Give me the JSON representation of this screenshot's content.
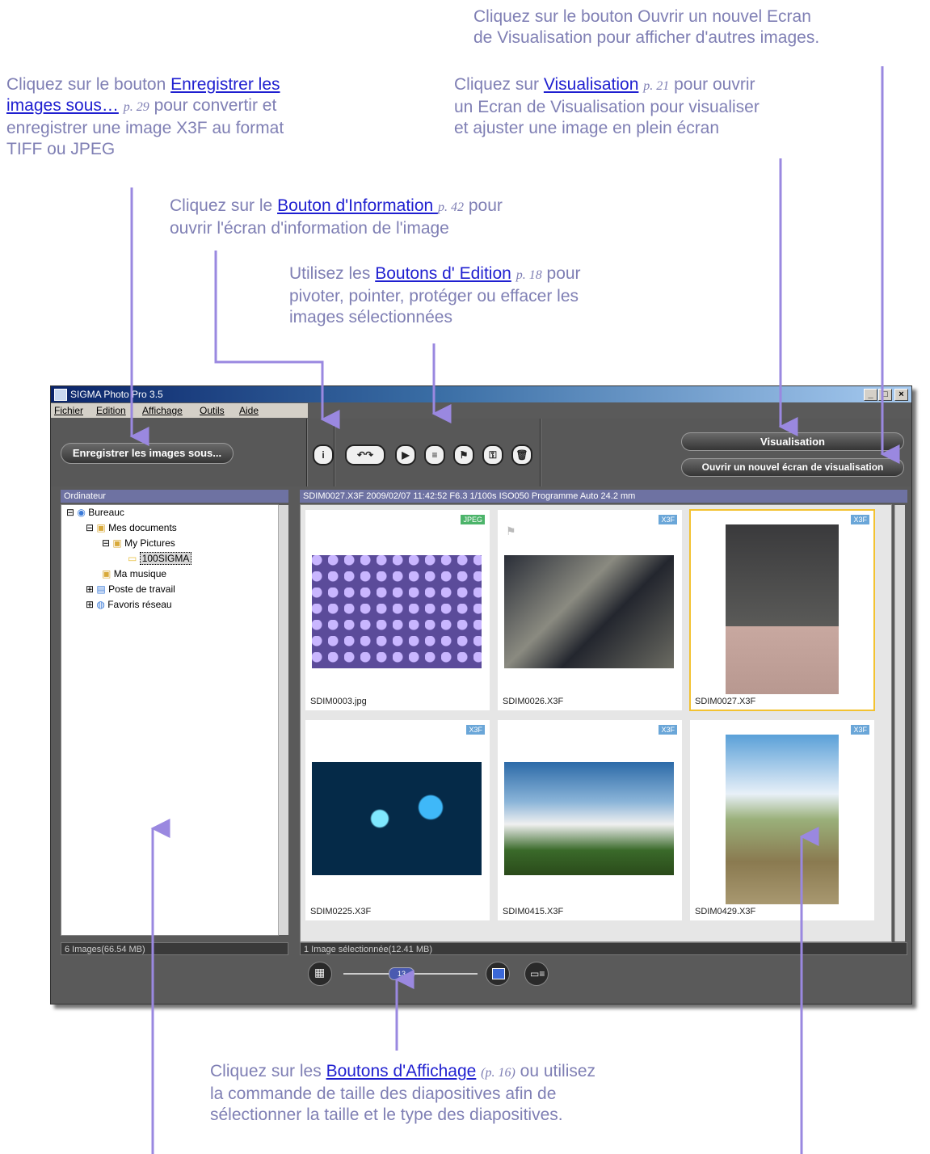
{
  "annotations": {
    "top_right": [
      "Cliquez sur le bouton Ouvrir un nouvel Ecran",
      "de Visualisation pour afficher d'autres images."
    ],
    "visualisation": {
      "before": "Cliquez sur ",
      "link": "Visualisation",
      "page": "p. 21",
      "after_line1": " pour ouvrir",
      "line2": "un Ecran de Visualisation pour visualiser",
      "line3": "et ajuster une image en plein écran"
    },
    "save": {
      "before": "Cliquez sur le bouton ",
      "link1": "Enregistrer les",
      "link2": "images sous…",
      "page": "p. 29",
      "after": " pour convertir et",
      "line3": "enregistrer  une image X3F au format",
      "line4": "TIFF ou JPEG"
    },
    "info": {
      "before": "Cliquez sur le ",
      "link": "Bouton d'Information ",
      "page": "p. 42",
      "after": " pour",
      "line2": "ouvrir l'écran d'information de l'image"
    },
    "edit": {
      "before": "Utilisez les ",
      "link": "Boutons d' Edition",
      "page": "p. 18",
      "after": " pour",
      "line2": "pivoter, pointer, protéger ou effacer les",
      "line3": "images sélectionnées"
    },
    "display": {
      "before": "Cliquez sur les ",
      "link": "Boutons d'Affichage",
      "page": "(p. 16)",
      "after": " ou utilisez",
      "line2": "la commande de taille des diapositives afin de",
      "line3": "sélectionner la taille et le type des diapositives."
    }
  },
  "window": {
    "title": "SIGMA Photo Pro 3.5",
    "menu": [
      "Fichier",
      "Edition",
      "Affichage",
      "Outils",
      "Aide"
    ],
    "save_button": "Enregistrer les images sous...",
    "visualisation_button": "Visualisation",
    "new_view_button": "Ouvrir un nouvel écran de visualisation",
    "left_panel_title": "Ordinateur",
    "info_bar": "SDIM0027.X3F 2009/02/07 11:42:52 F6.3 1/100s ISO050 Programme Auto 24.2 mm",
    "tree": [
      "Bureauc",
      "Mes documents",
      "My Pictures",
      "100SIGMA",
      "Ma musique",
      "Poste de travail",
      "Favoris réseau"
    ],
    "left_status": "6 Images(66.54 MB)",
    "right_status": "1 Image sélectionnée(12.41 MB)",
    "slider_value": "13",
    "thumbnails": [
      {
        "name": "SDIM0003.jpg",
        "badge": "JPEG"
      },
      {
        "name": "SDIM0026.X3F",
        "badge": "X3F"
      },
      {
        "name": "SDIM0027.X3F",
        "badge": "X3F"
      },
      {
        "name": "SDIM0225.X3F",
        "badge": "X3F"
      },
      {
        "name": "SDIM0415.X3F",
        "badge": "X3F"
      },
      {
        "name": "SDIM0429.X3F",
        "badge": "X3F"
      }
    ]
  }
}
